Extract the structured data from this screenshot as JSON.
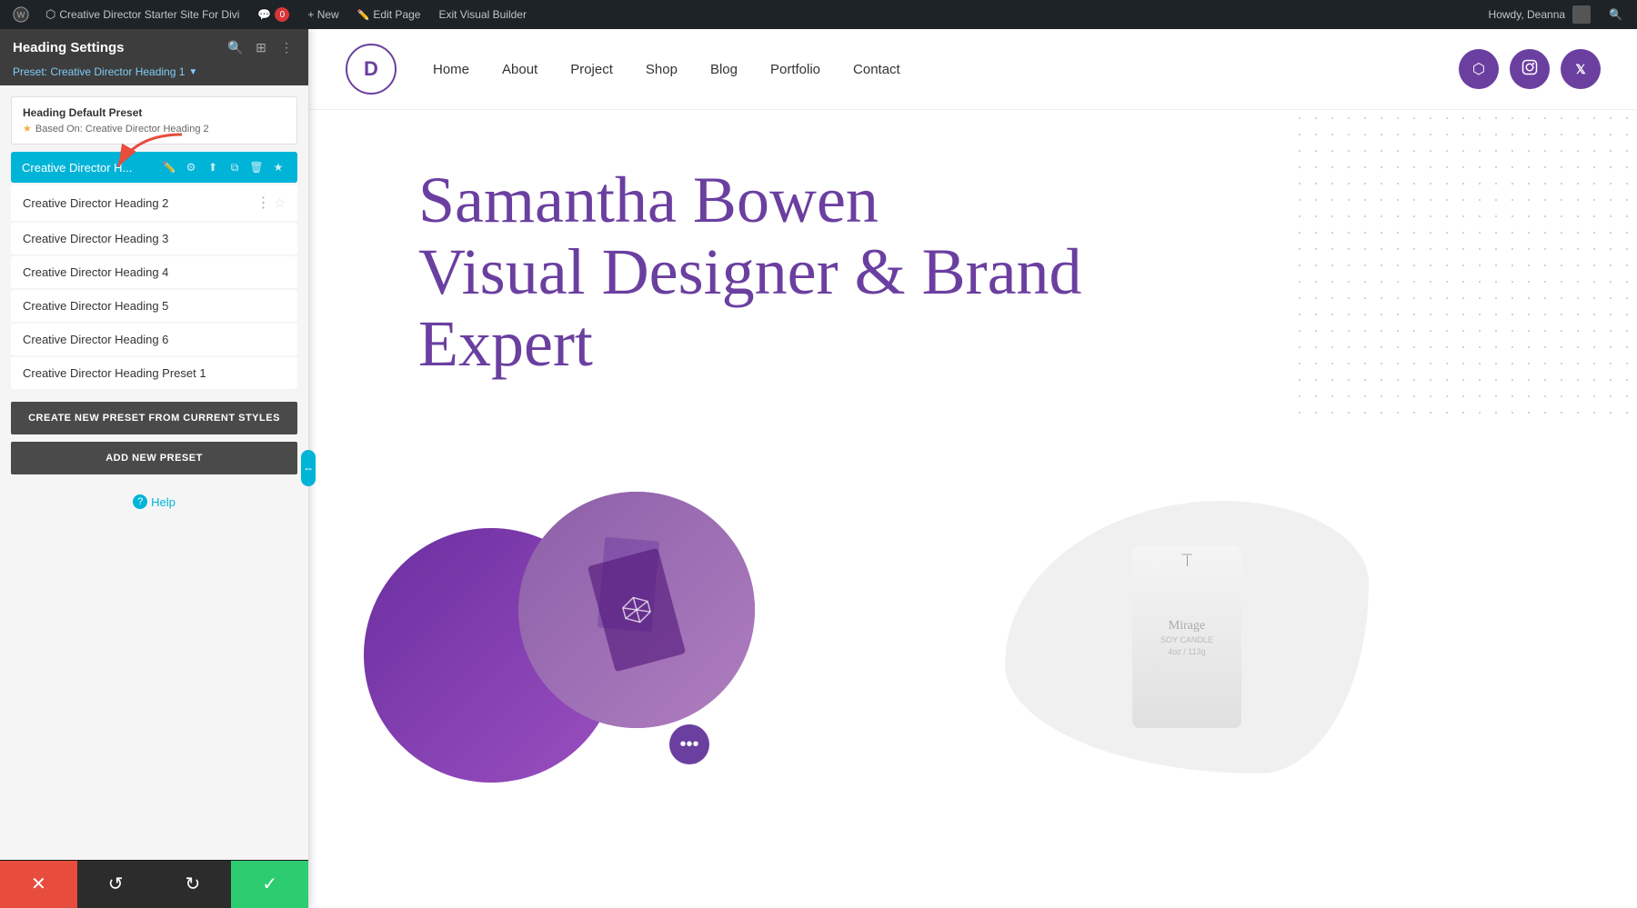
{
  "admin_bar": {
    "wp_icon": "W",
    "site_name": "Creative Director Starter Site For Divi",
    "comments_count": "0",
    "new_label": "+ New",
    "edit_page_label": "Edit Page",
    "exit_builder_label": "Exit Visual Builder",
    "howdy": "Howdy, Deanna"
  },
  "panel": {
    "title": "Heading Settings",
    "preset_subtitle": "Preset: Creative Director Heading 1",
    "default_preset_label": "Heading Default Preset",
    "based_on_label": "Based On: Creative Director Heading 2",
    "active_preset": "Creative Director H...",
    "presets": [
      {
        "label": "Creative Director Heading 2",
        "starred": false
      },
      {
        "label": "Creative Director Heading 3",
        "starred": false
      },
      {
        "label": "Creative Director Heading 4",
        "starred": false
      },
      {
        "label": "Creative Director Heading 5",
        "starred": false
      },
      {
        "label": "Creative Director Heading 6",
        "starred": false
      },
      {
        "label": "Creative Director Heading Preset 1",
        "starred": false
      }
    ],
    "btn_create": "CREATE NEW PRESET FROM CURRENT STYLES",
    "btn_add": "ADD NEW PRESET",
    "help_label": "Help"
  },
  "toolbar": {
    "close_icon": "✕",
    "undo_icon": "↺",
    "redo_icon": "↻",
    "save_icon": "✓"
  },
  "website": {
    "logo_letter": "D",
    "nav_items": [
      "Home",
      "About",
      "Project",
      "Shop",
      "Blog",
      "Portfolio",
      "Contact"
    ],
    "hero_line1": "Samantha Bowen",
    "hero_line2": "Visual Designer & Brand",
    "hero_line3": "Expert",
    "social_icons": [
      "⬡",
      "📷",
      "𝕏"
    ]
  }
}
